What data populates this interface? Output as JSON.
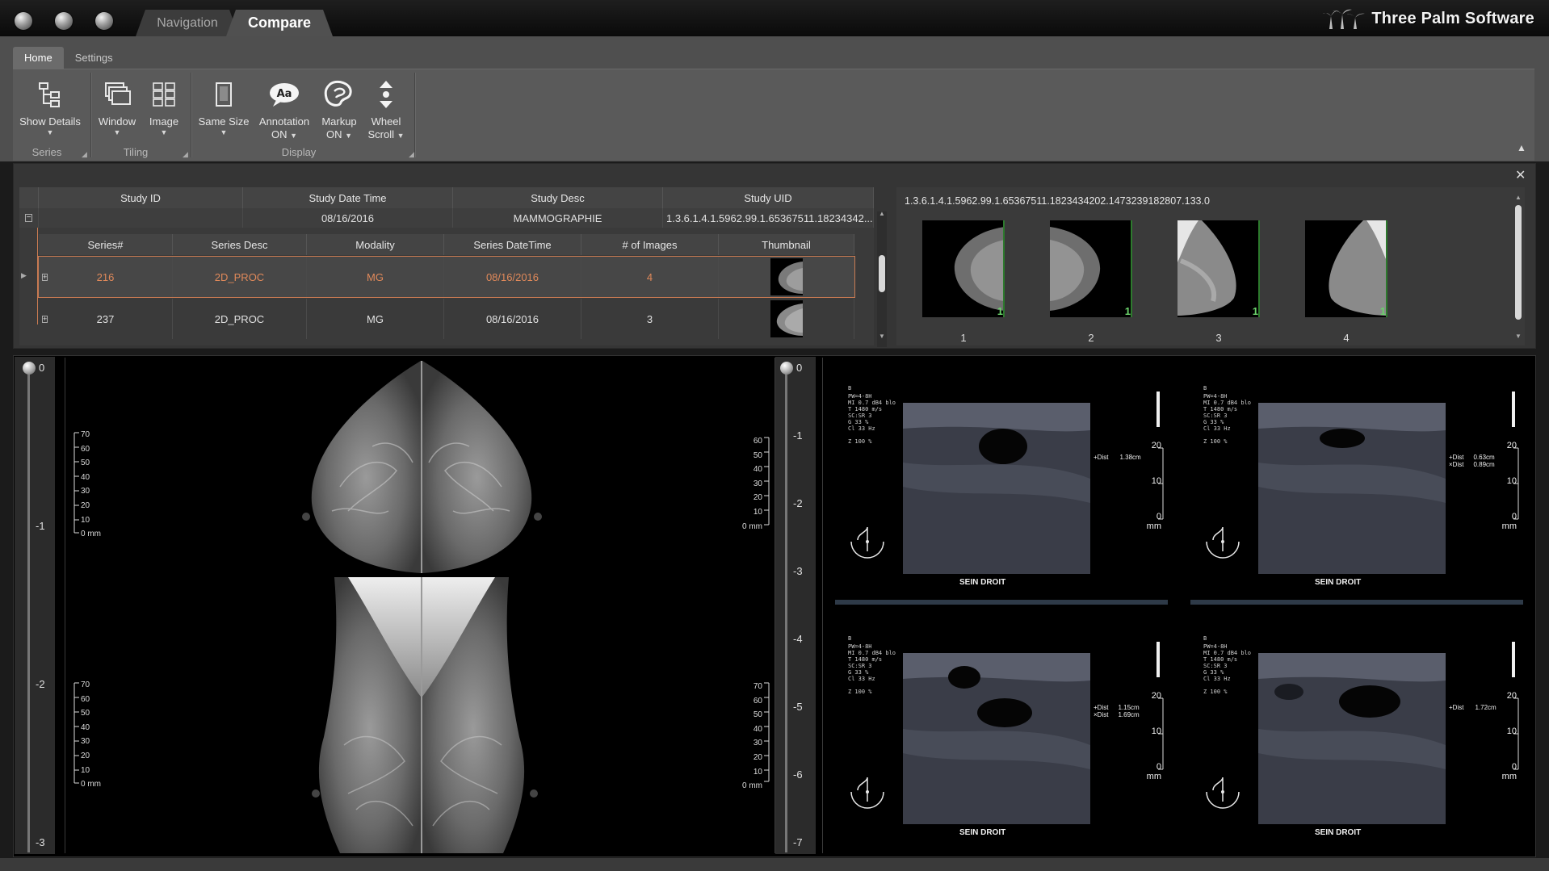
{
  "window": {
    "tabs": [
      {
        "label": "Navigation",
        "active": false
      },
      {
        "label": "Compare",
        "active": true
      }
    ],
    "brand": "Three Palm Software"
  },
  "ribbon": {
    "tabs": [
      {
        "label": "Home",
        "active": true
      },
      {
        "label": "Settings",
        "active": false
      }
    ],
    "groups": {
      "series": "Series",
      "tiling": "Tiling",
      "display": "Display"
    },
    "buttons": {
      "show_details": "Show Details",
      "window": "Window",
      "image": "Image",
      "same_size": "Same Size",
      "annotation_1": "Annotation",
      "annotation_2": "ON",
      "markup_1": "Markup",
      "markup_2": "ON",
      "wheel_1": "Wheel",
      "wheel_2": "Scroll"
    }
  },
  "study": {
    "columns": [
      "Study ID",
      "Study Date Time",
      "Study Desc",
      "Study UID"
    ],
    "row": {
      "id": "",
      "date": "08/16/2016",
      "desc": "MAMMOGRAPHIE",
      "uid": "1.3.6.1.4.1.5962.99.1.65367511.18234342..."
    },
    "series_columns": [
      "Series#",
      "Series Desc",
      "Modality",
      "Series DateTime",
      "# of Images",
      "Thumbnail"
    ],
    "series": [
      {
        "num": "216",
        "desc": "2D_PROC",
        "modality": "MG",
        "datetime": "08/16/2016",
        "images": "4",
        "selected": true
      },
      {
        "num": "237",
        "desc": "2D_PROC",
        "modality": "MG",
        "datetime": "08/16/2016",
        "images": "3",
        "selected": false
      }
    ]
  },
  "thumbnails": {
    "uid": "1.3.6.1.4.1.5962.99.1.65367511.1823434202.1473239182807.133.0",
    "items": [
      {
        "num": "1",
        "badge": "1"
      },
      {
        "num": "2",
        "badge": "1"
      },
      {
        "num": "3",
        "badge": "1"
      },
      {
        "num": "4",
        "badge": "1"
      }
    ]
  },
  "viewer_left": {
    "slider_labels": [
      "0",
      "-1",
      "-2",
      "-3"
    ],
    "ruler_left": [
      "70",
      "60",
      "50",
      "40",
      "30",
      "20",
      "10",
      "0 mm"
    ],
    "ruler_right": [
      "60",
      "50",
      "40",
      "30",
      "20",
      "10",
      "0 mm"
    ],
    "ruler_right2": [
      "70",
      "60",
      "50",
      "40",
      "30",
      "20",
      "10",
      "0 mm"
    ]
  },
  "viewer_right": {
    "slider_labels": [
      "0",
      "-1",
      "-2",
      "-3",
      "-4",
      "-5",
      "-6",
      "-7"
    ],
    "tiles": [
      {
        "label": "SEIN DROIT",
        "meas": [
          "+Dist",
          "1.38cm"
        ],
        "scale": [
          "20",
          "10",
          "0 mm"
        ]
      },
      {
        "label": "SEIN DROIT",
        "meas": [
          "+Dist",
          "0.63cm",
          "×Dist",
          "0.89cm"
        ],
        "scale": [
          "20",
          "10",
          "0 mm"
        ]
      },
      {
        "label": "SEIN DROIT",
        "meas": [
          "+Dist",
          "1.15cm",
          "×Dist",
          "1.69cm"
        ],
        "scale": [
          "20",
          "10",
          "0 mm"
        ]
      },
      {
        "label": "SEIN DROIT",
        "meas": [
          "+Dist",
          "1.72cm"
        ],
        "scale": [
          "20",
          "10",
          "0 mm"
        ]
      }
    ]
  }
}
